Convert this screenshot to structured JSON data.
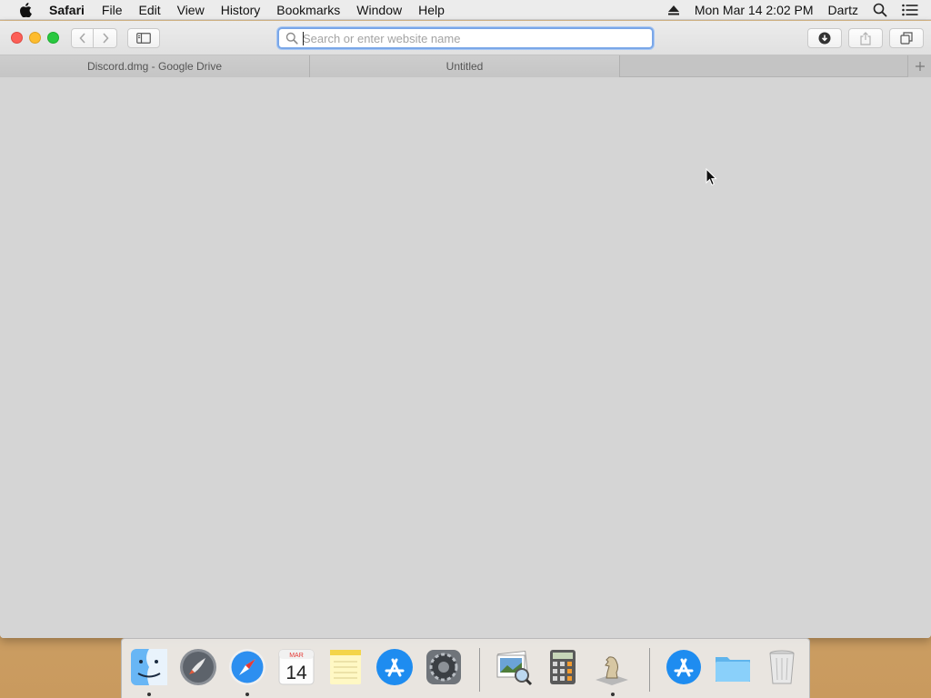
{
  "menubar": {
    "apple_icon": "apple-logo-icon",
    "app_name": "Safari",
    "items": [
      "File",
      "Edit",
      "View",
      "History",
      "Bookmarks",
      "Window",
      "Help"
    ],
    "datetime": "Mon Mar 14  2:02 PM",
    "user": "Dartz"
  },
  "window": {
    "address_bar": {
      "placeholder": "Search or enter website name",
      "value": ""
    },
    "tabs": [
      {
        "label": "Discord.dmg - Google Drive"
      },
      {
        "label": "Untitled"
      }
    ]
  },
  "dock": {
    "calendar": {
      "month": "MAR",
      "day": "14"
    },
    "items": [
      {
        "name": "Finder",
        "running": true
      },
      {
        "name": "Launchpad",
        "running": false
      },
      {
        "name": "Safari",
        "running": true
      },
      {
        "name": "Calendar",
        "running": false
      },
      {
        "name": "Notes",
        "running": false
      },
      {
        "name": "App Store",
        "running": false
      },
      {
        "name": "System Preferences",
        "running": false
      },
      {
        "name": "Preview",
        "running": false
      },
      {
        "name": "Calculator",
        "running": false
      },
      {
        "name": "Chess",
        "running": true
      },
      {
        "name": "App Store Downloads",
        "running": false
      },
      {
        "name": "Folder",
        "running": false
      },
      {
        "name": "Trash",
        "running": false
      }
    ]
  },
  "colors": {
    "traffic_close": "#fc5f57",
    "traffic_minimize": "#fdbc2e",
    "traffic_zoom": "#29c840",
    "address_focus": "#7aa7e8"
  }
}
